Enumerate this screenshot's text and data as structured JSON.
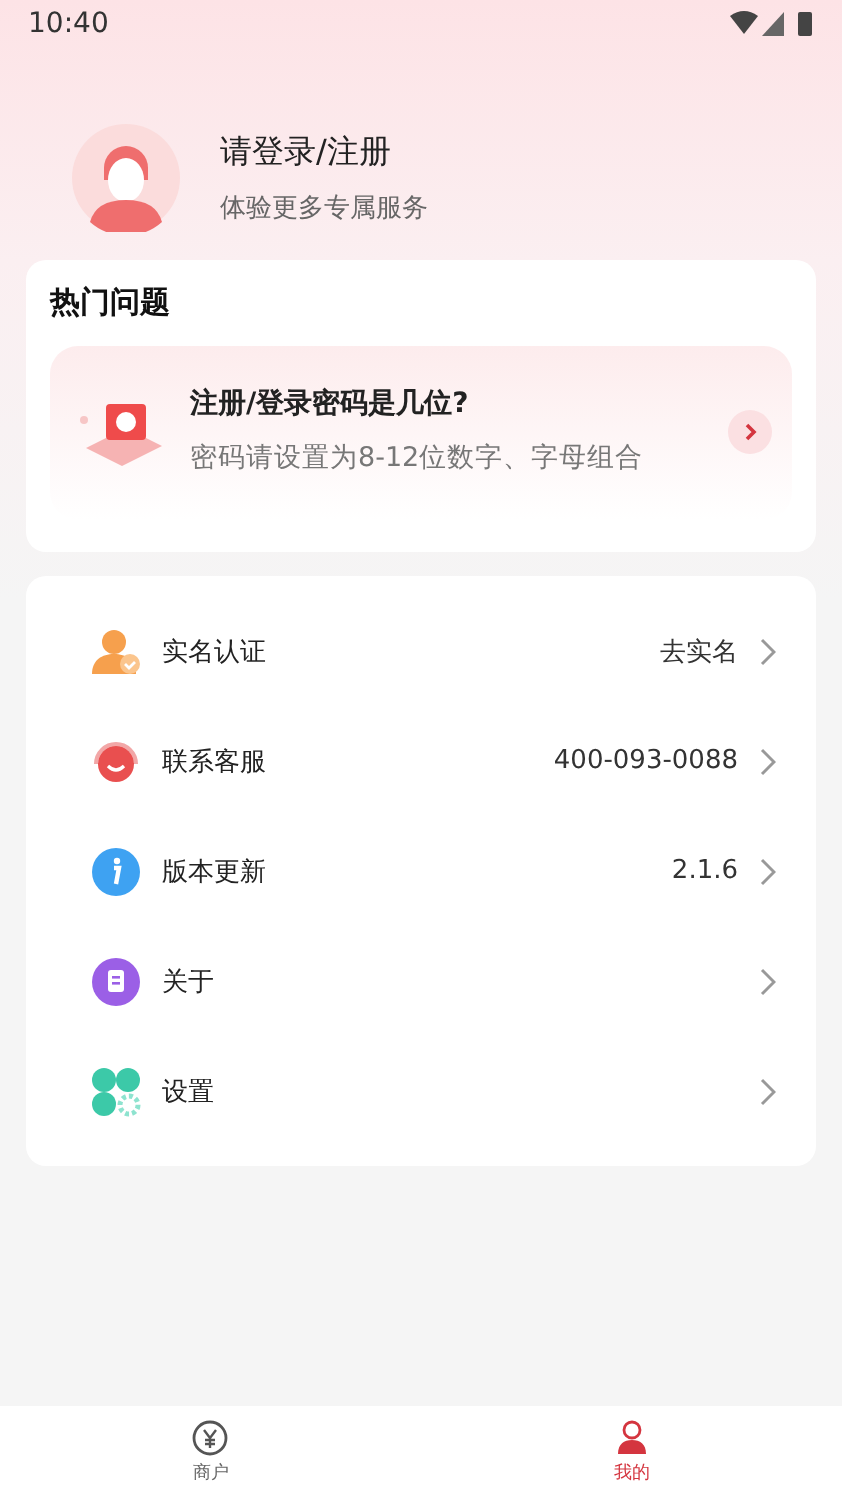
{
  "status_bar": {
    "time": "10:40"
  },
  "profile": {
    "title": "请登录/注册",
    "subtitle": "体验更多专属服务"
  },
  "hot_questions": {
    "title": "热门问题",
    "items": [
      {
        "question": "注册/登录密码是几位?",
        "answer": "密码请设置为8-12位数字、字母组合"
      }
    ]
  },
  "menu": [
    {
      "kind": "verify",
      "label": "实名认证",
      "value": "去实名"
    },
    {
      "kind": "service",
      "label": "联系客服",
      "value": "400-093-0088"
    },
    {
      "kind": "info",
      "label": "版本更新",
      "value": "2.1.6"
    },
    {
      "kind": "about",
      "label": "关于"
    },
    {
      "kind": "settings",
      "label": "设置"
    }
  ],
  "bottom_nav": [
    {
      "kind": "merchant",
      "label": "商户",
      "selected": false
    },
    {
      "kind": "mine",
      "label": "我的",
      "selected": true
    }
  ]
}
